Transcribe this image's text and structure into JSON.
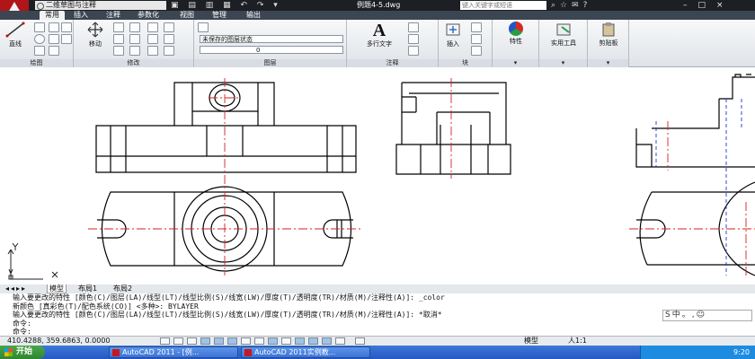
{
  "title_bar": {
    "workspace": "二维草图与注释",
    "document_title": "例题4-5.dwg",
    "search_placeholder": "键入关键字或短语"
  },
  "ribbon_tabs": [
    "常用",
    "插入",
    "注释",
    "参数化",
    "视图",
    "管理",
    "输出"
  ],
  "ribbon": {
    "draw": {
      "title": "绘图",
      "line_label": "直线"
    },
    "modify": {
      "title": "修改",
      "move_label": "移动"
    },
    "layers": {
      "title": "图层",
      "layer_state": "未保存的图层状态",
      "current_layer": "0"
    },
    "annotation": {
      "title": "注释",
      "mtext_label": "多行文字"
    },
    "block": {
      "title": "块",
      "insert_label": "插入"
    },
    "properties": {
      "label": "特性"
    },
    "utilities": {
      "label": "实用工具"
    },
    "clipboard": {
      "label": "剪贴板"
    }
  },
  "layout_tabs": [
    "模型",
    "布局1",
    "布局2"
  ],
  "command_history": [
    "输入要更改的特性 [颜色(C)/图层(LA)/线型(LT)/线型比例(S)/线宽(LW)/厚度(T)/透明度(TR)/材质(M)/注释性(A)]: _color",
    "新颜色 [真彩色(T)/配色系统(CO)] <多种>: BYLAYER",
    "输入要更改的特性 [颜色(C)/图层(LA)/线型(LT)/线型比例(S)/线宽(LW)/厚度(T)/透明度(TR)/材质(M)/注释性(A)]: *取消*",
    "命令:",
    "命令:"
  ],
  "ime_bar": "S中。,☺",
  "status_bar": {
    "coordinates": "410.4288, 359.6863, 0.0000",
    "space": "模型",
    "annotation_scale": "人1:1"
  },
  "taskbar": {
    "start_label": "开始",
    "tasks": [
      "AutoCAD 2011 - [例...",
      "AutoCAD 2011实例教..."
    ],
    "clock": "9:20"
  },
  "colors": {
    "drawing_lines": "#000000",
    "center_lines": "#d42020",
    "hidden_lines": "#2233d8",
    "title_bar": "#1c1f24",
    "taskbar": "#2f65d0"
  }
}
